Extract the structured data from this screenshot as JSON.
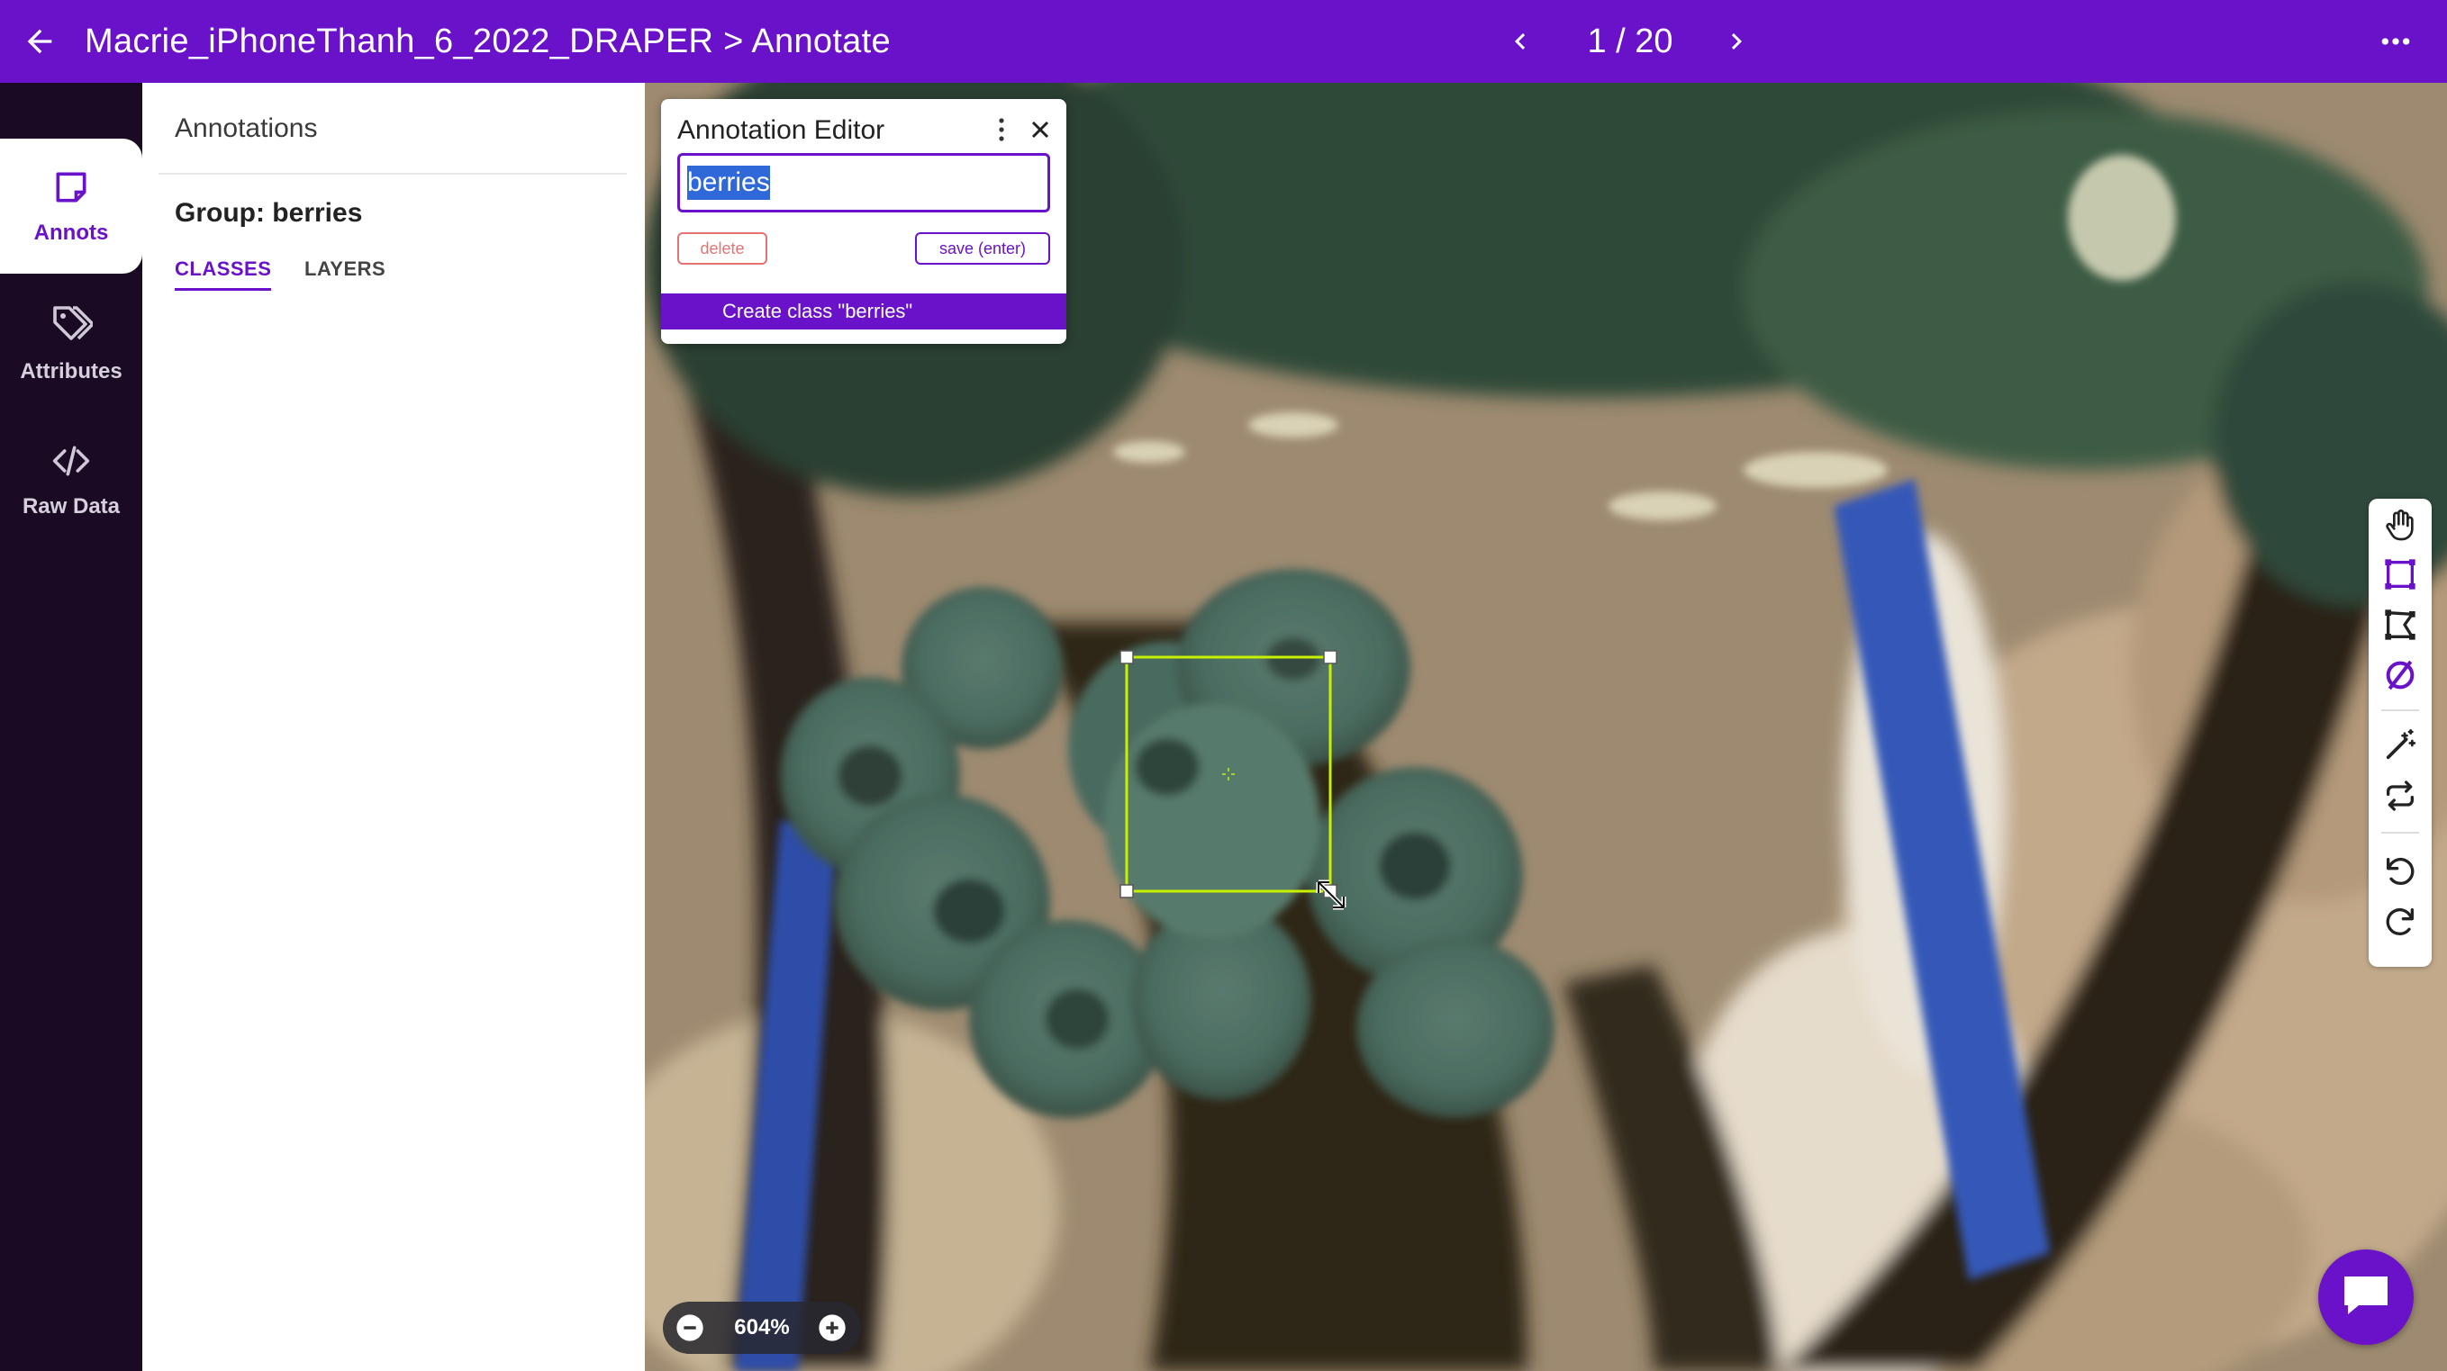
{
  "topbar": {
    "title": "Macrie_iPhoneThanh_6_2022_DRAPER > Annotate",
    "page_indicator": "1 / 20",
    "bg_color": "#6a12c9"
  },
  "rail": {
    "tabs": [
      {
        "label": "Annots",
        "icon": "sticky-note-icon",
        "active": true
      },
      {
        "label": "Attributes",
        "icon": "tags-icon",
        "active": false
      },
      {
        "label": "Raw Data",
        "icon": "code-icon",
        "active": false
      }
    ]
  },
  "panel": {
    "heading": "Annotations",
    "group_title": "Group: berries",
    "tabs": [
      {
        "label": "CLASSES",
        "active": true
      },
      {
        "label": "LAYERS",
        "active": false
      }
    ]
  },
  "editor": {
    "title": "Annotation Editor",
    "input_value": "berries",
    "delete_label": "delete",
    "save_label": "save (enter)",
    "create_label": "Create class \"berries\""
  },
  "annotation": {
    "box_color": "#c8f000"
  },
  "toolbar": {
    "tools": [
      "hand-pan-icon",
      "bounding-box-icon",
      "polygon-icon",
      "no-visibility-icon",
      "magic-wand-icon",
      "swap-icon",
      "undo-icon",
      "redo-icon"
    ]
  },
  "zoom": {
    "value": "604%"
  }
}
